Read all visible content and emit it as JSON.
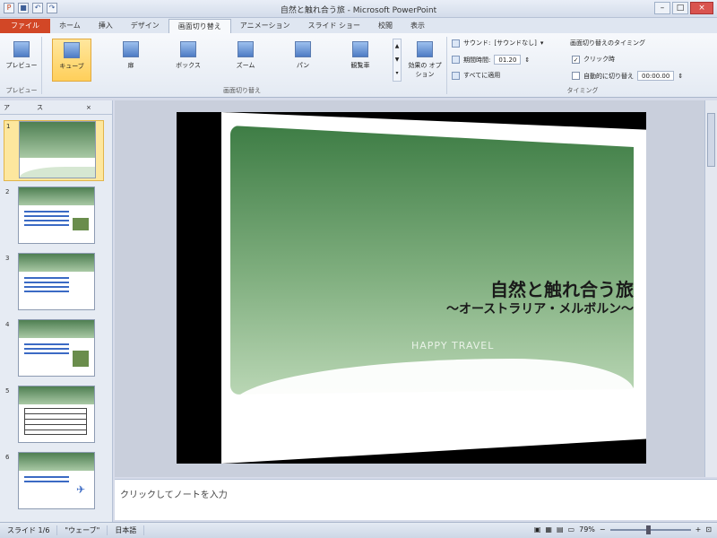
{
  "window": {
    "title": "自然と触れ合う旅 - Microsoft PowerPoint"
  },
  "tabs": [
    "ファイル",
    "ホーム",
    "挿入",
    "デザイン",
    "画面切り替え",
    "アニメーション",
    "スライド ショー",
    "校閲",
    "表示"
  ],
  "ribbon": {
    "preview_label": "プレビュー",
    "preview_group": "プレビュー",
    "transitions": [
      "キューブ",
      "扉",
      "ボックス",
      "ズーム",
      "パン",
      "観覧車"
    ],
    "effect_options": "効果の オプション",
    "transition_group": "画面切り替え",
    "sound_label": "サウンド:",
    "sound_value": "[サウンドなし]",
    "duration_label": "期間時間:",
    "duration_value": "01.20",
    "apply_all": "すべてに適用",
    "timing_header": "画面切り替えのタイミング",
    "on_click": "クリック時",
    "auto_after": "自動的に切り替え",
    "auto_value": "00:00.00",
    "timing_group": "タイミング"
  },
  "panel": {
    "tab_outline": "ア",
    "tab_slides": "ス"
  },
  "slides": [
    {
      "num": "1"
    },
    {
      "num": "2"
    },
    {
      "num": "3"
    },
    {
      "num": "4"
    },
    {
      "num": "5"
    },
    {
      "num": "6"
    }
  ],
  "slide": {
    "title": "自然と触れ合う旅",
    "subtitle": "～オーストラリア・メルボルン～",
    "tagline": "HAPPY TRAVEL"
  },
  "notes": {
    "placeholder": "クリックしてノートを入力"
  },
  "status": {
    "slide": "スライド 1/6",
    "theme": "\"ウェーブ\"",
    "lang": "日本語",
    "zoom": "79%"
  }
}
